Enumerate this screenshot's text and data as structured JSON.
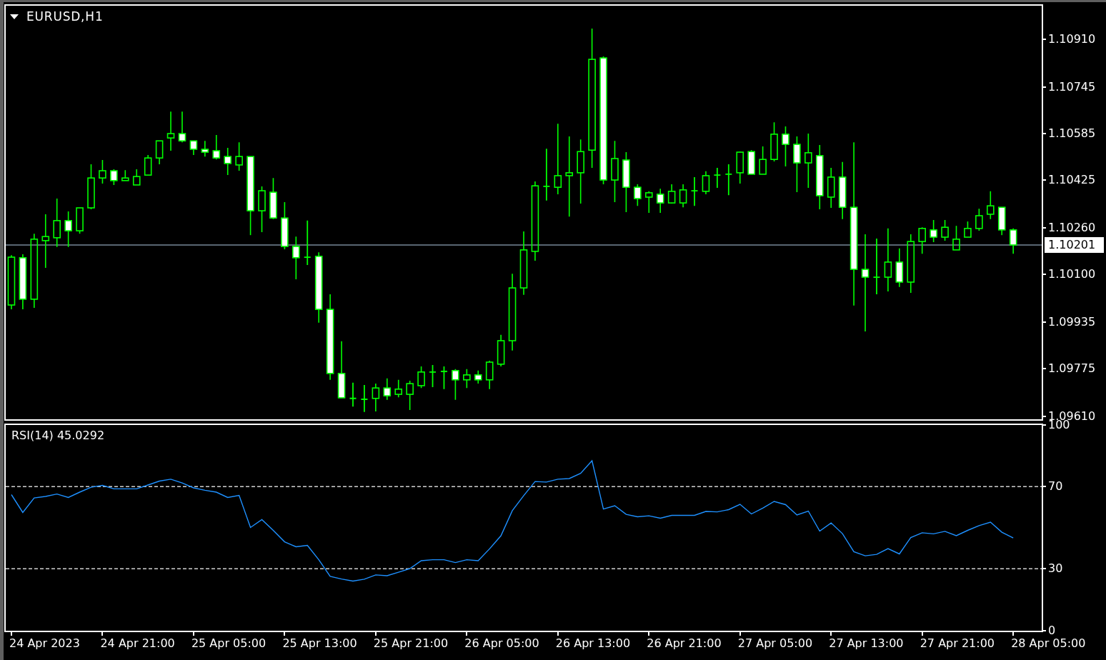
{
  "price_chart": {
    "chart_data": {
      "type": "candlestick",
      "title": "EURUSD,H1",
      "categories": [
        null,
        null,
        null,
        null,
        null,
        null,
        null,
        null,
        null,
        null,
        null,
        null,
        null,
        null,
        null,
        null,
        null,
        null,
        null,
        null,
        null,
        null,
        null,
        null,
        null,
        null,
        null,
        null,
        null,
        null,
        null,
        null,
        null,
        null,
        null,
        null,
        null,
        null,
        null,
        null,
        null,
        null,
        null,
        null,
        null,
        null,
        null,
        null,
        null,
        null,
        null,
        null,
        null,
        null,
        null,
        null,
        null,
        null,
        null,
        null,
        null,
        null,
        null,
        null,
        null,
        null,
        null,
        null,
        null,
        null,
        null,
        null,
        null,
        null,
        null,
        null,
        null,
        null,
        null,
        null,
        null,
        null,
        null,
        null,
        null,
        null,
        null,
        null,
        null,
        null,
        null
      ],
      "ohlc": [
        [
          1.09994,
          1.10166,
          1.09979,
          1.10159
        ],
        [
          1.10157,
          1.10169,
          1.09979,
          1.10014
        ],
        [
          1.10014,
          1.1024,
          1.09984,
          1.10221
        ],
        [
          1.10216,
          1.10307,
          1.10122,
          1.1023
        ],
        [
          1.10226,
          1.10361,
          1.10194,
          1.10285
        ],
        [
          1.10285,
          1.10317,
          1.10194,
          1.1025
        ],
        [
          1.1025,
          1.10329,
          1.1024,
          1.10329
        ],
        [
          1.10329,
          1.10479,
          1.10324,
          1.10432
        ],
        [
          1.10432,
          1.10494,
          1.10413,
          1.10457
        ],
        [
          1.10457,
          1.10462,
          1.10408,
          1.10423
        ],
        [
          1.10423,
          1.10459,
          1.10423,
          1.10432
        ],
        [
          1.10408,
          1.10462,
          1.10408,
          1.10437
        ],
        [
          1.10442,
          1.10511,
          1.10442,
          1.10501
        ],
        [
          1.10501,
          1.1056,
          1.10479,
          1.1056
        ],
        [
          1.1057,
          1.10661,
          1.10526,
          1.10585
        ],
        [
          1.10585,
          1.10661,
          1.10555,
          1.1056
        ],
        [
          1.1056,
          1.1056,
          1.10511,
          1.10531
        ],
        [
          1.10531,
          1.1056,
          1.10506,
          1.10521
        ],
        [
          1.10526,
          1.1058,
          1.10496,
          1.10501
        ],
        [
          1.10506,
          1.10536,
          1.10442,
          1.10482
        ],
        [
          1.10477,
          1.10555,
          1.10457,
          1.10506
        ],
        [
          1.10506,
          1.10506,
          1.10235,
          1.10319
        ],
        [
          1.10319,
          1.10403,
          1.10245,
          1.10388
        ],
        [
          1.10383,
          1.10432,
          1.1029,
          1.10294
        ],
        [
          1.10294,
          1.10349,
          1.10186,
          1.10196
        ],
        [
          1.10196,
          1.1023,
          1.10083,
          1.10157
        ],
        [
          1.10159,
          1.10285,
          1.10132,
          1.10159
        ],
        [
          1.10162,
          1.10176,
          1.09933,
          1.09979
        ],
        [
          1.09979,
          1.10031,
          1.09736,
          1.09758
        ],
        [
          1.09758,
          1.09869,
          1.09674,
          1.09674
        ],
        [
          1.09672,
          1.09726,
          1.09644,
          1.09672
        ],
        [
          1.09669,
          1.09718,
          1.09625,
          1.09669
        ],
        [
          1.09672,
          1.09723,
          1.09627,
          1.09708
        ],
        [
          1.09708,
          1.09741,
          1.09667,
          1.09681
        ],
        [
          1.09686,
          1.09736,
          1.09676,
          1.09704
        ],
        [
          1.09686,
          1.09733,
          1.09632,
          1.09723
        ],
        [
          1.09716,
          1.09782,
          1.09708,
          1.09763
        ],
        [
          1.09763,
          1.09787,
          1.09711,
          1.09763
        ],
        [
          1.09765,
          1.09782,
          1.09704,
          1.09765
        ],
        [
          1.09768,
          1.09773,
          1.09667,
          1.09736
        ],
        [
          1.09736,
          1.09773,
          1.09708,
          1.09753
        ],
        [
          1.09753,
          1.09768,
          1.09723,
          1.09736
        ],
        [
          1.09736,
          1.09802,
          1.09704,
          1.09797
        ],
        [
          1.0979,
          1.09891,
          1.09782,
          1.09871
        ],
        [
          1.09871,
          1.10102,
          1.09837,
          1.10053
        ],
        [
          1.10053,
          1.10248,
          1.10029,
          1.10184
        ],
        [
          1.10179,
          1.1042,
          1.10147,
          1.10405
        ],
        [
          1.10403,
          1.10533,
          1.10354,
          1.10403
        ],
        [
          1.104,
          1.10619,
          1.10376,
          1.1044
        ],
        [
          1.1044,
          1.10575,
          1.10299,
          1.1045
        ],
        [
          1.1045,
          1.10565,
          1.10344,
          1.10523
        ],
        [
          1.10528,
          1.10947,
          1.10467,
          1.10841
        ],
        [
          1.10846,
          1.10851,
          1.1041,
          1.10425
        ],
        [
          1.10425,
          1.1056,
          1.10349,
          1.10499
        ],
        [
          1.10494,
          1.10521,
          1.10314,
          1.104
        ],
        [
          1.104,
          1.1041,
          1.10336,
          1.10361
        ],
        [
          1.10366,
          1.10386,
          1.10312,
          1.10381
        ],
        [
          1.10376,
          1.10395,
          1.10312,
          1.10346
        ],
        [
          1.10346,
          1.1041,
          1.10344,
          1.10386
        ],
        [
          1.10346,
          1.1041,
          1.10331,
          1.10391
        ],
        [
          1.10388,
          1.10435,
          1.10336,
          1.10388
        ],
        [
          1.10386,
          1.10455,
          1.10376,
          1.1044
        ],
        [
          1.10442,
          1.10467,
          1.10398,
          1.10442
        ],
        [
          1.10445,
          1.10479,
          1.10373,
          1.10445
        ],
        [
          1.1045,
          1.10523,
          1.10413,
          1.10521
        ],
        [
          1.10523,
          1.10528,
          1.10445,
          1.10445
        ],
        [
          1.10445,
          1.10541,
          1.10445,
          1.10496
        ],
        [
          1.10496,
          1.10624,
          1.10489,
          1.10583
        ],
        [
          1.10583,
          1.1061,
          1.10472,
          1.10548
        ],
        [
          1.10548,
          1.10575,
          1.10383,
          1.10484
        ],
        [
          1.10484,
          1.10585,
          1.10398,
          1.10519
        ],
        [
          1.10509,
          1.10546,
          1.10324,
          1.10371
        ],
        [
          1.10366,
          1.10467,
          1.10329,
          1.10435
        ],
        [
          1.10435,
          1.10487,
          1.1029,
          1.10331
        ],
        [
          1.10331,
          1.10555,
          1.09992,
          1.10117
        ],
        [
          1.10117,
          1.10238,
          1.09903,
          1.1009
        ],
        [
          1.1009,
          1.10223,
          1.10031,
          1.1009
        ],
        [
          1.1009,
          1.10258,
          1.10041,
          1.10142
        ],
        [
          1.10142,
          1.10189,
          1.10056,
          1.10073
        ],
        [
          1.10073,
          1.10238,
          1.10036,
          1.10213
        ],
        [
          1.10213,
          1.10262,
          1.10171,
          1.10258
        ],
        [
          1.10253,
          1.10287,
          1.10211,
          1.10228
        ],
        [
          1.10228,
          1.10287,
          1.10216,
          1.10262
        ],
        [
          1.10184,
          1.10267,
          1.10184,
          1.10221
        ],
        [
          1.10228,
          1.10282,
          1.10228,
          1.10258
        ],
        [
          1.10258,
          1.10326,
          1.1025,
          1.10302
        ],
        [
          1.10307,
          1.10386,
          1.1029,
          1.10336
        ],
        [
          1.10331,
          1.10331,
          1.10235,
          1.10253
        ],
        [
          1.10253,
          1.10258,
          1.10171,
          1.10201
        ],
        null,
        null
      ],
      "ylim": [
        1.096,
        1.11026
      ],
      "yticks": [
        {
          "value": 1.1091,
          "label": "1.10910"
        },
        {
          "value": 1.10745,
          "label": "1.10745"
        },
        {
          "value": 1.10585,
          "label": "1.10585"
        },
        {
          "value": 1.10425,
          "label": "1.10425"
        },
        {
          "value": 1.1026,
          "label": "1.10260"
        },
        {
          "value": 1.101,
          "label": "1.10100"
        },
        {
          "value": 1.09935,
          "label": "1.09935"
        },
        {
          "value": 1.09775,
          "label": "1.09775"
        },
        {
          "value": 1.0961,
          "label": "1.09610"
        }
      ],
      "ref_lines": [
        {
          "axis": "y",
          "value": 1.10201,
          "label": "1.10201"
        }
      ]
    }
  },
  "indicator_pane": {
    "chart_data": {
      "type": "line",
      "title": "RSI(14) 45.0292",
      "values": [
        66.1,
        57.4,
        64.5,
        65.2,
        66.4,
        64.7,
        67.3,
        69.7,
        70.6,
        68.9,
        68.9,
        68.9,
        70.8,
        72.7,
        73.6,
        71.8,
        69.4,
        68.2,
        67.3,
        64.7,
        65.7,
        50.1,
        53.9,
        48.7,
        43.1,
        40.7,
        41.4,
        34.4,
        26.3,
        25.0,
        24.0,
        24.9,
        27.0,
        26.6,
        28.3,
        30.1,
        33.9,
        34.4,
        34.4,
        33.0,
        34.4,
        33.9,
        39.7,
        46.1,
        58.3,
        65.6,
        72.5,
        72.2,
        73.6,
        73.9,
        76.5,
        82.6,
        59.1,
        60.7,
        56.5,
        55.3,
        55.8,
        54.6,
        56.0,
        56.0,
        56.0,
        57.9,
        57.7,
        58.8,
        61.4,
        56.7,
        59.5,
        62.8,
        61.2,
        56.2,
        58.1,
        48.3,
        52.3,
        47.1,
        38.3,
        36.3,
        37.0,
        39.8,
        37.2,
        45.2,
        47.5,
        47.0,
        48.2,
        46.1,
        48.7,
        51.0,
        52.7,
        47.8,
        45.0
      ],
      "ylim": [
        0,
        100
      ],
      "yticks": [
        100,
        70,
        30,
        0
      ],
      "ref_lines": [
        {
          "axis": "y",
          "value": 70
        },
        {
          "axis": "y",
          "value": 30
        }
      ]
    }
  },
  "time_axis": {
    "labels": [
      "24 Apr 2023",
      "24 Apr 21:00",
      "25 Apr 05:00",
      "25 Apr 13:00",
      "25 Apr 21:00",
      "26 Apr 05:00",
      "26 Apr 13:00",
      "26 Apr 21:00",
      "27 Apr 05:00",
      "27 Apr 13:00",
      "27 Apr 21:00",
      "28 Apr 05:00"
    ]
  }
}
